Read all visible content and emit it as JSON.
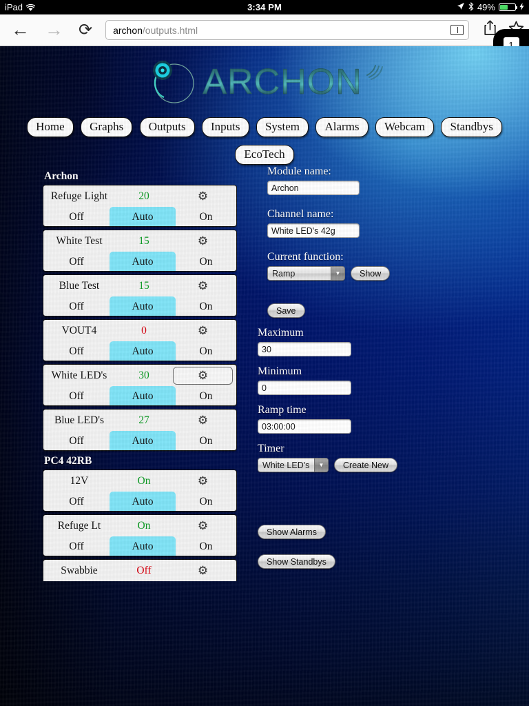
{
  "statusbar": {
    "carrier": "iPad",
    "wifi_icon": "wifi-icon",
    "time": "3:34 PM",
    "location_icon": "location-arrow-icon",
    "bluetooth_icon": "bluetooth-icon",
    "battery_percent": "49%",
    "battery_level": 49,
    "charging_icon": "lightning-bolt-icon"
  },
  "browser": {
    "back_icon": "back-arrow-icon",
    "forward_icon": "forward-arrow-icon",
    "reload_icon": "reload-icon",
    "url_host": "archon",
    "url_path": "/outputs.html",
    "reader_icon": "reader-view-icon",
    "share_icon": "share-icon",
    "bookmark_icon": "bookmark-star-icon",
    "tab_count": "1"
  },
  "brand": {
    "logo_text": "ARCHON",
    "logo_mark_icon": "archon-swirl-icon",
    "wifi_waves_icon": "signal-waves-icon"
  },
  "nav": {
    "row1": [
      {
        "label": "Home"
      },
      {
        "label": "Graphs"
      },
      {
        "label": "Outputs"
      },
      {
        "label": "Inputs"
      },
      {
        "label": "System"
      },
      {
        "label": "Alarms"
      },
      {
        "label": "Webcam"
      },
      {
        "label": "Standbys"
      }
    ],
    "row2": [
      {
        "label": "EcoTech"
      }
    ]
  },
  "outputs": {
    "gear_icon": "gear-icon",
    "seg_off_label": "Off",
    "seg_auto_label": "Auto",
    "seg_on_label": "On",
    "groups": [
      {
        "title": "Archon",
        "channels": [
          {
            "name": "Refuge Light",
            "value": "20",
            "value_state": "green",
            "mode": "Auto",
            "selected": false
          },
          {
            "name": "White Test",
            "value": "15",
            "value_state": "green",
            "mode": "Auto",
            "selected": false
          },
          {
            "name": "Blue Test",
            "value": "15",
            "value_state": "green",
            "mode": "Auto",
            "selected": false
          },
          {
            "name": "VOUT4",
            "value": "0",
            "value_state": "red",
            "mode": "Auto",
            "selected": false
          },
          {
            "name": "White LED's",
            "value": "30",
            "value_state": "green",
            "mode": "Auto",
            "selected": true
          },
          {
            "name": "Blue LED's",
            "value": "27",
            "value_state": "green",
            "mode": "Auto",
            "selected": false
          }
        ]
      },
      {
        "title": "PC4 42RB",
        "channels": [
          {
            "name": "12V",
            "value": "On",
            "value_state": "green",
            "mode": "Auto",
            "selected": false
          },
          {
            "name": "Refuge Lt",
            "value": "On",
            "value_state": "green",
            "mode": "Auto",
            "selected": false
          },
          {
            "name": "Swabbie",
            "value": "Off",
            "value_state": "red",
            "mode": "Auto",
            "selected": false
          }
        ]
      }
    ]
  },
  "detail": {
    "module_name_label": "Module name:",
    "module_name_value": "Archon",
    "channel_name_label": "Channel name:",
    "channel_name_value": "White LED's 42g",
    "current_function_label": "Current function:",
    "current_function_value": "Ramp",
    "show_button": "Show",
    "save_button": "Save",
    "maximum_label": "Maximum",
    "maximum_value": "30",
    "minimum_label": "Minimum",
    "minimum_value": "0",
    "ramp_time_label": "Ramp time",
    "ramp_time_value": "03:00:00",
    "timer_label": "Timer",
    "timer_value": "White LED's",
    "create_new_button": "Create New",
    "show_alarms_button": "Show Alarms",
    "show_standbys_button": "Show Standbys",
    "dropdown_arrow_icon": "chevron-down-icon"
  },
  "colors": {
    "auto_highlight": "#7fe3f7",
    "value_green": "#0a9a22",
    "value_red": "#d6000e",
    "card_bg": "#f2f2f2",
    "battery_green": "#4cd964"
  }
}
